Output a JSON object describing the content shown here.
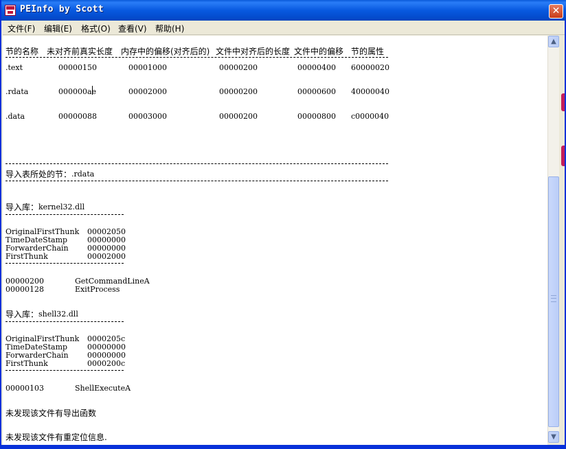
{
  "window": {
    "title": "PEInfo by Scott",
    "close_symbol": "✕",
    "icon": "peinfo-app-icon"
  },
  "menu": [
    "文件(F)",
    "编辑(E)",
    "格式(O)",
    "查看(V)",
    "帮助(H)"
  ],
  "sections": {
    "headers": [
      "节的名称",
      "未对齐前真实长度",
      "内存中的偏移(对齐后的)",
      "文件中对齐后的长度",
      "文件中的偏移",
      "节的属性"
    ],
    "rows": [
      [
        ".text",
        "00000150",
        "00001000",
        "00000200",
        "00000400",
        "60000020"
      ],
      [
        ".rdata",
        "000000ae",
        "00002000",
        "00000200",
        "00000600",
        "40000040"
      ],
      [
        ".data",
        "00000088",
        "00003000",
        "00000200",
        "00000800",
        "c0000040"
      ]
    ]
  },
  "import_section": {
    "label": "导入表所处的节：",
    "value": ".rdata"
  },
  "libraries": [
    {
      "label": "导入库：",
      "name": "kernel32.dll",
      "fields": [
        [
          "OriginalFirstThunk",
          "00002050"
        ],
        [
          "TimeDateStamp",
          "00000000"
        ],
        [
          "ForwarderChain",
          "00000000"
        ],
        [
          "FirstThunk",
          "00002000"
        ]
      ],
      "functions": [
        [
          "00000200",
          "GetCommandLineA"
        ],
        [
          "00000128",
          "ExitProcess"
        ]
      ]
    },
    {
      "label": "导入库：",
      "name": "shell32.dll",
      "fields": [
        [
          "OriginalFirstThunk",
          "0000205c"
        ],
        [
          "TimeDateStamp",
          "00000000"
        ],
        [
          "ForwarderChain",
          "00000000"
        ],
        [
          "FirstThunk",
          "0000200c"
        ]
      ],
      "functions": [
        [
          "00000103",
          "ShellExecuteA"
        ]
      ]
    }
  ],
  "messages": {
    "no_export": "未发现该文件有导出函数",
    "no_reloc": "未发现该文件有重定位信息."
  },
  "scrollbar": {
    "up_arrow": "▲",
    "down_arrow": "▼"
  },
  "colors": {
    "titlebar": "#0859e0",
    "close_button": "#c83d1a",
    "window_face": "#ece9d8"
  }
}
